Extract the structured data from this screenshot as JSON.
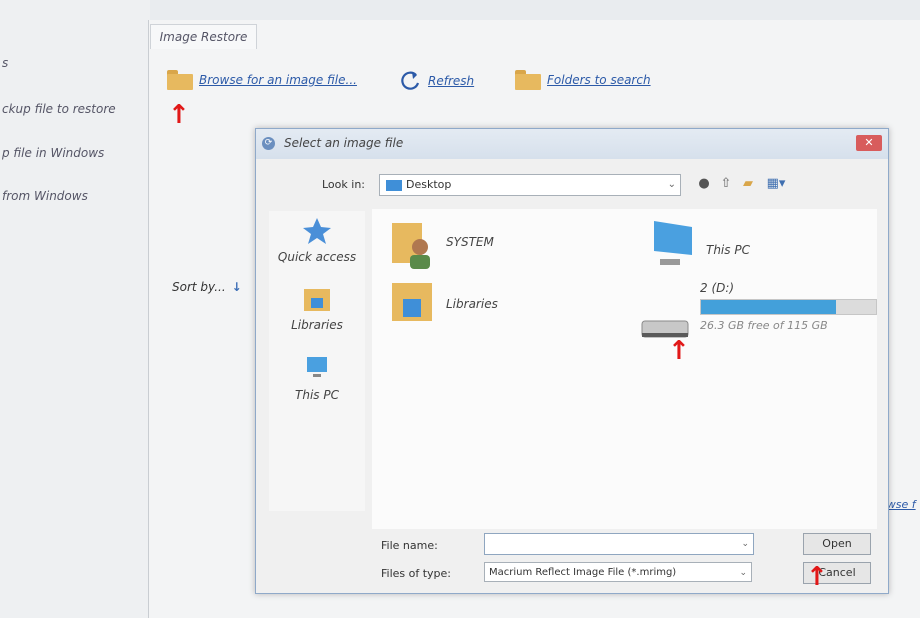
{
  "left_panel": {
    "items": [
      "s",
      "ckup file to restore",
      "p file in Windows",
      "from Windows"
    ]
  },
  "main_window": {
    "tab": "Image Restore",
    "toolbar": {
      "browse_label": "Browse for an image file...",
      "refresh_label": "Refresh",
      "folders_label": "Folders to search"
    },
    "sort_by": "Sort by...",
    "right_edge_text": "owse f"
  },
  "dialog": {
    "title": "Select an image file",
    "look_in_label": "Look in:",
    "look_in_value": "Desktop",
    "places": [
      {
        "label": "Quick access",
        "icon": "star-icon"
      },
      {
        "label": "Libraries",
        "icon": "libraries-icon"
      },
      {
        "label": "This PC",
        "icon": "computer-icon"
      }
    ],
    "files": [
      {
        "label": "SYSTEM",
        "icon": "user-folder-icon"
      },
      {
        "label": "Libraries",
        "icon": "libraries-icon"
      },
      {
        "label": "This PC",
        "icon": "computer-icon"
      }
    ],
    "drive": {
      "label": "2 (D:)",
      "free_text": "26.3 GB free of 115 GB",
      "used_fraction": 0.77,
      "bar_color": "#43a0da"
    },
    "file_name_label": "File name:",
    "file_name_value": "",
    "file_type_label": "Files of type:",
    "file_type_value": "Macrium Reflect Image File (*.mrimg)",
    "open_label": "Open",
    "cancel_label": "Cancel"
  },
  "colors": {
    "arrow": "#e11818",
    "link": "#2c5aa8"
  }
}
